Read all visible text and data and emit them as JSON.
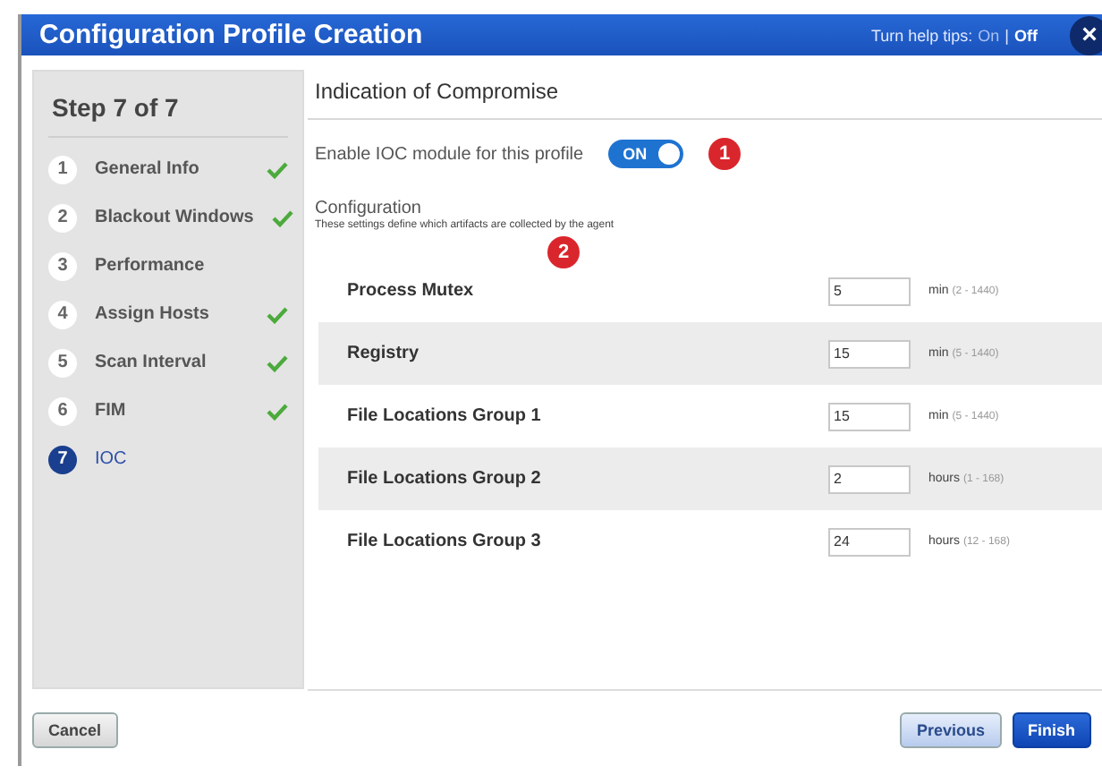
{
  "window": {
    "title": "Configuration Profile Creation",
    "close": "×"
  },
  "help_tips": {
    "label": "Turn help tips:",
    "separator": "|",
    "options": [
      {
        "label": "On",
        "selected": false
      },
      {
        "label": "Off",
        "selected": true
      }
    ]
  },
  "sidebar": {
    "title": "Step 7 of 7",
    "steps": [
      {
        "number": "1",
        "label": "General Info",
        "done": true,
        "selected": false
      },
      {
        "number": "2",
        "label": "Blackout Windows",
        "done": true,
        "selected": false
      },
      {
        "number": "3",
        "label": "Performance",
        "done": false,
        "selected": false
      },
      {
        "number": "4",
        "label": "Assign Hosts",
        "done": true,
        "selected": false
      },
      {
        "number": "5",
        "label": "Scan Interval",
        "done": true,
        "selected": false
      },
      {
        "number": "6",
        "label": "FIM",
        "done": true,
        "selected": false
      },
      {
        "number": "7",
        "label": "IOC",
        "done": false,
        "selected": true
      }
    ]
  },
  "main": {
    "heading": "Indication of Compromise",
    "enable": {
      "label": "Enable IOC module for this profile",
      "on": true,
      "toggle_text": "ON",
      "marker": "1"
    },
    "configuration": {
      "title": "Configuration",
      "description": "These settings define which artifacts are collected by the agent",
      "marker": "2"
    },
    "settings": [
      {
        "name": "Process Mutex",
        "value": "5",
        "unit": "min",
        "range": "(2 - 1440)"
      },
      {
        "name": "Registry",
        "value": "15",
        "unit": "min",
        "range": "(5 - 1440)"
      },
      {
        "name": "File Locations Group 1",
        "value": "15",
        "unit": "min",
        "range": "(5 - 1440)"
      },
      {
        "name": "File Locations Group 2",
        "value": "2",
        "unit": "hours",
        "range": "(1 - 168)"
      },
      {
        "name": "File Locations Group 3",
        "value": "24",
        "unit": "hours",
        "range": "(12 - 168)"
      }
    ]
  },
  "buttons": {
    "cancel": "Cancel",
    "previous": "Previous",
    "finish": "Finish"
  }
}
